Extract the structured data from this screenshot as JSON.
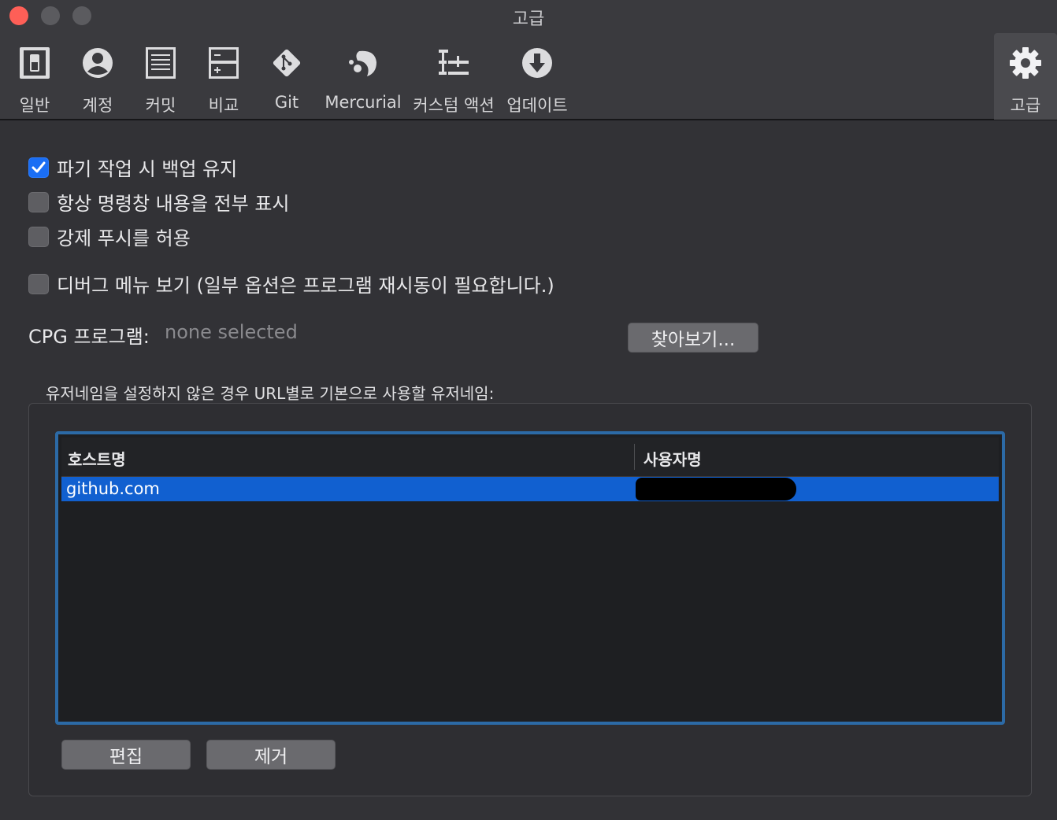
{
  "window": {
    "title": "고급"
  },
  "toolbar": {
    "items": [
      {
        "label": "일반",
        "icon": "switch-icon"
      },
      {
        "label": "계정",
        "icon": "account-icon"
      },
      {
        "label": "커밋",
        "icon": "document-icon"
      },
      {
        "label": "비교",
        "icon": "diff-icon"
      },
      {
        "label": "Git",
        "icon": "git-icon"
      },
      {
        "label": "Mercurial",
        "icon": "mercurial-icon"
      },
      {
        "label": "커스텀 액션",
        "icon": "custom-actions-icon"
      },
      {
        "label": "업데이트",
        "icon": "download-icon"
      },
      {
        "label": "고급",
        "icon": "gear-icon",
        "active": true
      }
    ]
  },
  "options": {
    "keep_backup": {
      "label": "파기 작업 시 백업 유지",
      "checked": true
    },
    "show_full_command": {
      "label": "항상 명령창 내용을 전부 표시",
      "checked": false
    },
    "allow_force_push": {
      "label": "강제 푸시를 허용",
      "checked": false
    },
    "debug_menu": {
      "label": "디버그 메뉴 보기 (일부 옵션은 프로그램 재시동이 필요합니다.)",
      "checked": false
    }
  },
  "gpg": {
    "label": "CPG 프로그램:",
    "value": "none selected",
    "browse_label": "찾아보기..."
  },
  "usernames": {
    "caption": "유저네임을 설정하지 않은 경우 URL별로 기본으로 사용할 유저네임:",
    "columns": [
      "호스트명",
      "사용자명"
    ],
    "rows": [
      {
        "host": "github.com",
        "user": ""
      }
    ],
    "edit_label": "편집",
    "remove_label": "제거"
  },
  "colors": {
    "accent": "#1a6ef4",
    "selection": "#1160d0",
    "close": "#fe5f57"
  }
}
